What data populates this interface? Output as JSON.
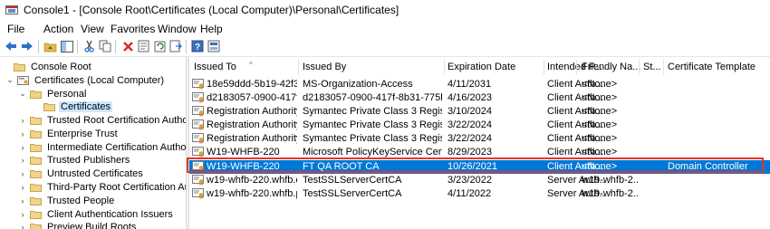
{
  "window": {
    "title": "Console1 - [Console Root\\Certificates (Local Computer)\\Personal\\Certificates]"
  },
  "menu": [
    "File",
    "Action",
    "View",
    "Favorites",
    "Window",
    "Help"
  ],
  "toolbar": [
    "back-arrow-icon",
    "forward-arrow-icon",
    "up-folder-icon",
    "show-hide-tree-icon",
    "cut-icon",
    "copy-icon",
    "delete-icon",
    "properties-icon",
    "refresh-icon",
    "export-icon",
    "help-icon",
    "mmc-icon"
  ],
  "tree": [
    {
      "label": "Console Root"
    },
    {
      "label": "Certificates (Local Computer)"
    },
    {
      "label": "Personal"
    },
    {
      "label": "Certificates"
    },
    {
      "label": "Trusted Root Certification Authoriti"
    },
    {
      "label": "Enterprise Trust"
    },
    {
      "label": "Intermediate Certification Authoriti"
    },
    {
      "label": "Trusted Publishers"
    },
    {
      "label": "Untrusted Certificates"
    },
    {
      "label": "Third-Party Root Certification Autho"
    },
    {
      "label": "Trusted People"
    },
    {
      "label": "Client Authentication Issuers"
    },
    {
      "label": "Preview Build Roots"
    }
  ],
  "columns": [
    "Issued To",
    "Issued By",
    "Expiration Date",
    "Intended P...",
    "Friendly Na...",
    "St...",
    "Certificate Template"
  ],
  "rows": [
    [
      "18e59ddd-5b19-42f3-...",
      "MS-Organization-Access",
      "4/11/2031",
      "Client Auth...",
      "<None>",
      "",
      ""
    ],
    [
      "d2183057-0900-417f-8...",
      "d2183057-0900-417f-8b31-775b15...",
      "4/16/2023",
      "Client Auth...",
      "<None>",
      "",
      ""
    ],
    [
      "Registration Authority...",
      "Symantec Private Class 3 Registrat...",
      "3/10/2024",
      "Client Auth...",
      "<None>",
      "",
      ""
    ],
    [
      "Registration Authority...",
      "Symantec Private Class 3 Registrat...",
      "3/22/2024",
      "Client Auth...",
      "<None>",
      "",
      ""
    ],
    [
      "Registration Authority...",
      "Symantec Private Class 3 Registrat...",
      "3/22/2024",
      "Client Auth...",
      "<None>",
      "",
      ""
    ],
    [
      "W19-WHFB-220",
      "Microsoft PolicyKeyService Certifi...",
      "8/29/2023",
      "Client Auth...",
      "<None>",
      "",
      ""
    ],
    [
      "W19-WHFB-220",
      "FT QA ROOT CA",
      "10/26/2021",
      "Client Auth...",
      "<None>",
      "",
      "Domain Controller"
    ],
    [
      "w19-whfb-220.whfb.d...",
      "TestSSLServerCertCA",
      "3/23/2022",
      "Server Auth...",
      "w19-whfb-2...",
      "",
      ""
    ],
    [
      "w19-whfb-220.whfb.p...",
      "TestSSLServerCertCA",
      "4/11/2022",
      "Server Auth...",
      "w19-whfb-2...",
      "",
      ""
    ]
  ],
  "selected_row": 6,
  "colors": {
    "selection": "#0078d7",
    "highlight_border": "#e0362c",
    "tree_selection": "#cce8ff"
  }
}
